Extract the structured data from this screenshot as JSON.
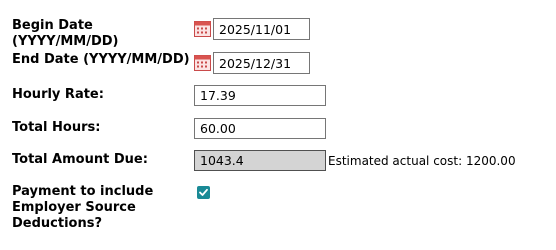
{
  "form": {
    "begin_date": {
      "label_line1": "Begin Date",
      "label_line2": "(YYYY/MM/DD)",
      "value": "2025/11/01",
      "icon": "calendar-icon"
    },
    "end_date": {
      "label": "End Date (YYYY/MM/DD)",
      "value": "2025/12/31",
      "icon": "calendar-icon"
    },
    "hourly_rate": {
      "label": "Hourly Rate:",
      "value": "17.39"
    },
    "total_hours": {
      "label": "Total Hours:",
      "value": "60.00"
    },
    "total_amount_due": {
      "label": "Total Amount Due:",
      "value": "1043.4",
      "estimated_note": "Estimated actual cost: 1200.00"
    },
    "payment_deductions": {
      "label_line1": "Payment to include",
      "label_line2": "Employer Source",
      "label_line3": "Deductions?",
      "checked": true
    }
  },
  "colors": {
    "checkbox_accent": "#1a8a96",
    "readonly_field_bg": "#d4d4d4",
    "calendar_icon": "#d9534f"
  }
}
